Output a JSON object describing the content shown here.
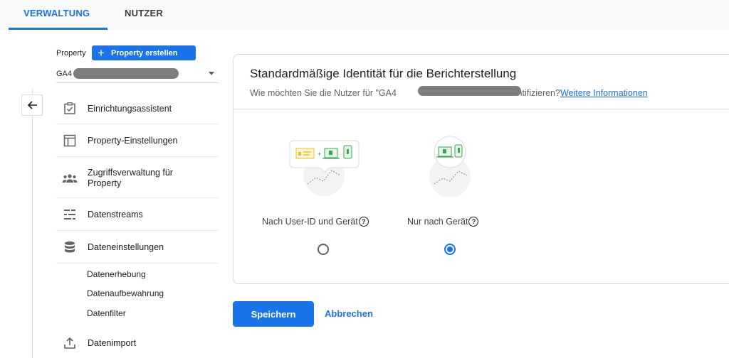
{
  "tabs": [
    {
      "label": "VERWALTUNG",
      "active": true
    },
    {
      "label": "NUTZER",
      "active": false
    }
  ],
  "sidebar": {
    "property_label": "Property",
    "create_button": "Property erstellen",
    "property_value": "GA4",
    "items": [
      {
        "label": "Einrichtungsassistent",
        "icon": "checklist-icon"
      },
      {
        "label": "Property-Einstellungen",
        "icon": "property-settings-icon"
      },
      {
        "label": "Zugriffsverwaltung für Property",
        "icon": "people-icon"
      },
      {
        "label": "Datenstreams",
        "icon": "data-streams-icon"
      },
      {
        "label": "Dateneinstellungen",
        "icon": "database-icon"
      },
      {
        "label": "Datenimport",
        "icon": "upload-icon"
      }
    ],
    "sub_items": [
      "Datenerhebung",
      "Datenaufbewahrung",
      "Datenfilter"
    ]
  },
  "card": {
    "title": "Standardmäßige Identität für die Berichterstellung",
    "subtitle_prefix": "Wie möchten Sie die Nutzer für \"GA4",
    "subtitle_suffix": "\" identifizieren?",
    "link": "Weitere Informationen",
    "options": [
      {
        "label": "Nach User-ID und Gerät",
        "selected": false
      },
      {
        "label": "Nur nach Gerät",
        "selected": true
      }
    ]
  },
  "actions": {
    "save": "Speichern",
    "cancel": "Abbrechen"
  },
  "colors": {
    "accent": "#1a73e8",
    "border": "#dadce0"
  }
}
